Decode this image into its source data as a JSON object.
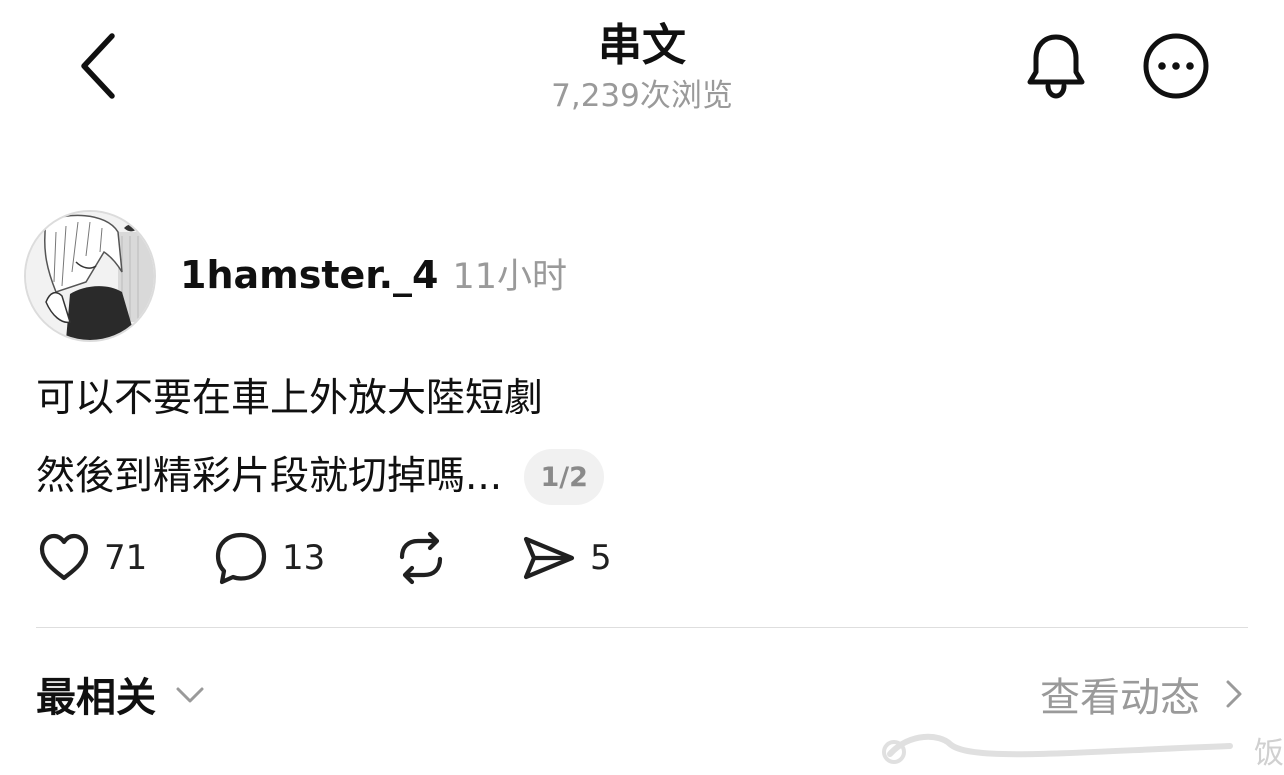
{
  "header": {
    "title": "串文",
    "views": "7,239次浏览"
  },
  "icons": {
    "back": "chevron-left-icon",
    "bell": "bell-icon",
    "more": "more-horizontal-icon",
    "like": "heart-icon",
    "comment": "comment-bubble-icon",
    "repost": "repost-icon",
    "share": "send-icon",
    "sort": "chevron-down-icon",
    "activity": "chevron-right-icon"
  },
  "post": {
    "username": "1hamster._4",
    "time": "11小时",
    "line1": "可以不要在車上外放大陸短劇",
    "line2": "然後到精彩片段就切掉嗎...",
    "page_indicator": "1/2",
    "likes": "71",
    "comments": "13",
    "shares": "5"
  },
  "footer": {
    "sort_label": "最相关",
    "activity_label": "查看动态"
  },
  "watermark": {
    "text": "饭"
  },
  "colors": {
    "primary_text": "#101010",
    "secondary_text": "#9a9a9a",
    "divider": "#dedede"
  }
}
